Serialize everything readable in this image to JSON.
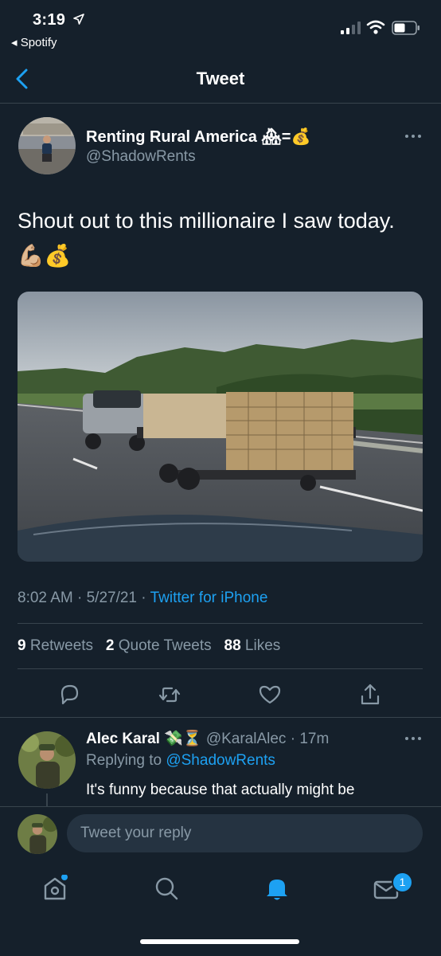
{
  "status_bar": {
    "time": "3:19",
    "back_app": "◂ Spotify"
  },
  "nav": {
    "title": "Tweet"
  },
  "tweet": {
    "author_name": "Renting Rural America 🏘=💰",
    "author_handle": "@ShadowRents",
    "text": "Shout out to this millionaire I saw today. 💪🏼💰",
    "time": "8:02 AM",
    "date": "5/27/21",
    "source": "Twitter for iPhone",
    "retweets_count": "9",
    "retweets_label": "Retweets",
    "quotes_count": "2",
    "quotes_label": "Quote Tweets",
    "likes_count": "88",
    "likes_label": "Likes"
  },
  "reply": {
    "name": "Alec Karal 💸⏳",
    "handle": "@KaralAlec",
    "time": "17m",
    "replying_prefix": "Replying to",
    "replying_to": "@ShadowRents",
    "text": "It's funny because that actually might be"
  },
  "composer": {
    "placeholder": "Tweet your reply"
  },
  "tabbar": {
    "messages_badge": "1"
  },
  "colors": {
    "background": "#15202b",
    "accent": "#1da1f2",
    "secondary_text": "#8899a6",
    "divider": "#38444d"
  }
}
